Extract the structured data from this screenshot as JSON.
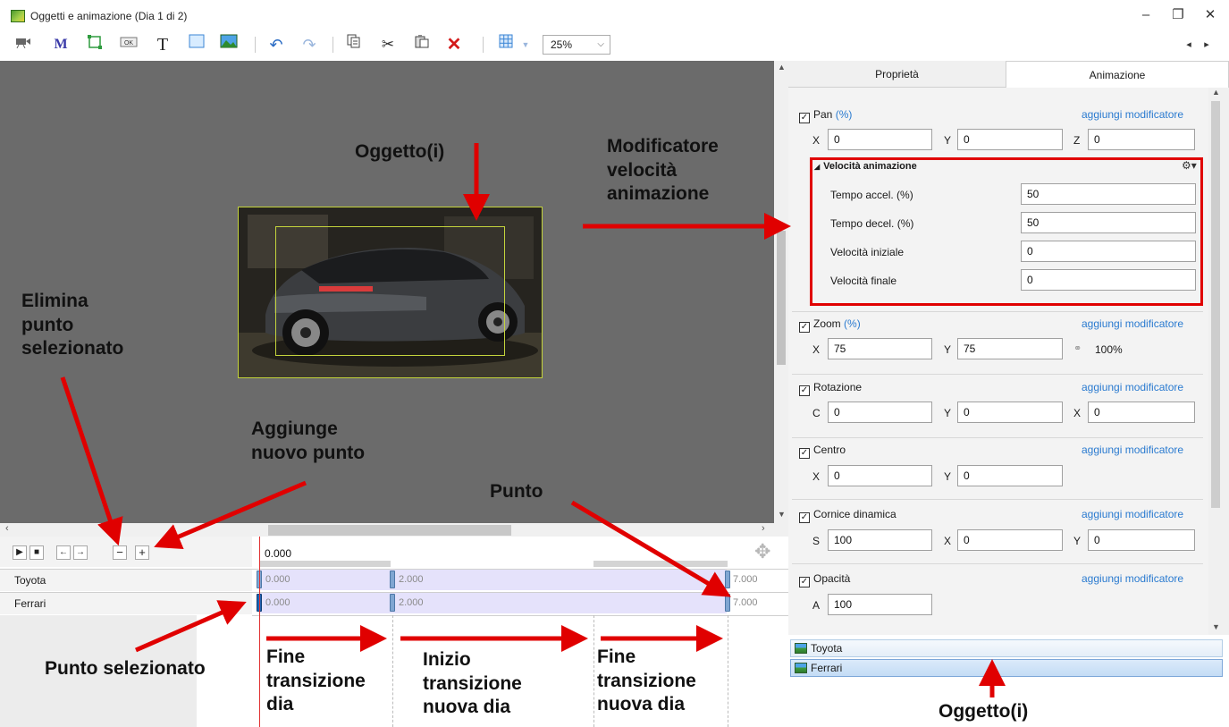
{
  "window": {
    "title": "Oggetti e animazione (Dia 1 di 2)",
    "minimize": "–",
    "restore": "❐",
    "close": "✕"
  },
  "toolbar": {
    "zoom_value": "25%",
    "nav_left": "◂",
    "nav_right": "▸"
  },
  "timeline": {
    "current_time": "0.000",
    "tracks": [
      {
        "name": "Toyota",
        "keyframes": [
          "0.000",
          "2.000",
          "7.000"
        ]
      },
      {
        "name": "Ferrari",
        "keyframes": [
          "0.000",
          "2.000",
          "7.000"
        ]
      }
    ]
  },
  "panel": {
    "tabs": [
      "Proprietà",
      "Animazione"
    ],
    "active_tab": "Animazione",
    "add_modifier": "aggiungi modificatore",
    "pan": {
      "title": "Pan",
      "unit": "(%)",
      "x_label": "X",
      "x": "0",
      "y_label": "Y",
      "y": "0",
      "z_label": "Z",
      "z": "0"
    },
    "speed": {
      "title": "Velocità animazione",
      "accel_label": "Tempo accel. (%)",
      "accel": "50",
      "decel_label": "Tempo decel. (%)",
      "decel": "50",
      "start_label": "Velocità iniziale",
      "start": "0",
      "end_label": "Velocità finale",
      "end": "0"
    },
    "zoom": {
      "title": "Zoom",
      "unit": "(%)",
      "x_label": "X",
      "x": "75",
      "y_label": "Y",
      "y": "75",
      "link_value": "100%"
    },
    "rotation": {
      "title": "Rotazione",
      "c_label": "C",
      "c": "0",
      "y_label": "Y",
      "y": "0",
      "x_label": "X",
      "x": "0"
    },
    "center": {
      "title": "Centro",
      "x_label": "X",
      "x": "0",
      "y_label": "Y",
      "y": "0"
    },
    "frame": {
      "title": "Cornice dinamica",
      "s_label": "S",
      "s": "100",
      "x_label": "X",
      "x": "0",
      "y_label": "Y",
      "y": "0"
    },
    "opacity": {
      "title": "Opacità",
      "a_label": "A",
      "a": "100"
    }
  },
  "objects": [
    "Toyota",
    "Ferrari"
  ],
  "annotations": {
    "oggetto_top": "Oggetto(i)",
    "modificatore": [
      "Modificatore",
      "velocità",
      "animazione"
    ],
    "elimina": [
      "Elimina",
      "punto",
      "selezionato"
    ],
    "aggiunge": [
      "Aggiunge",
      "nuovo punto"
    ],
    "punto": "Punto",
    "punto_selezionato": "Punto selezionato",
    "fine_transizione": [
      "Fine",
      "transizione",
      "dia"
    ],
    "inizio_transizione": [
      "Inizio",
      "transizione",
      "nuova dia"
    ],
    "fine_transizione_nuova": [
      "Fine",
      "transizione",
      "nuova dia"
    ],
    "oggetto_bottom": "Oggetto(i)"
  },
  "colors": {
    "annotation_red": "#e00000",
    "link_blue": "#2b7bd0",
    "keyframe_selected": "#1e64b4"
  }
}
